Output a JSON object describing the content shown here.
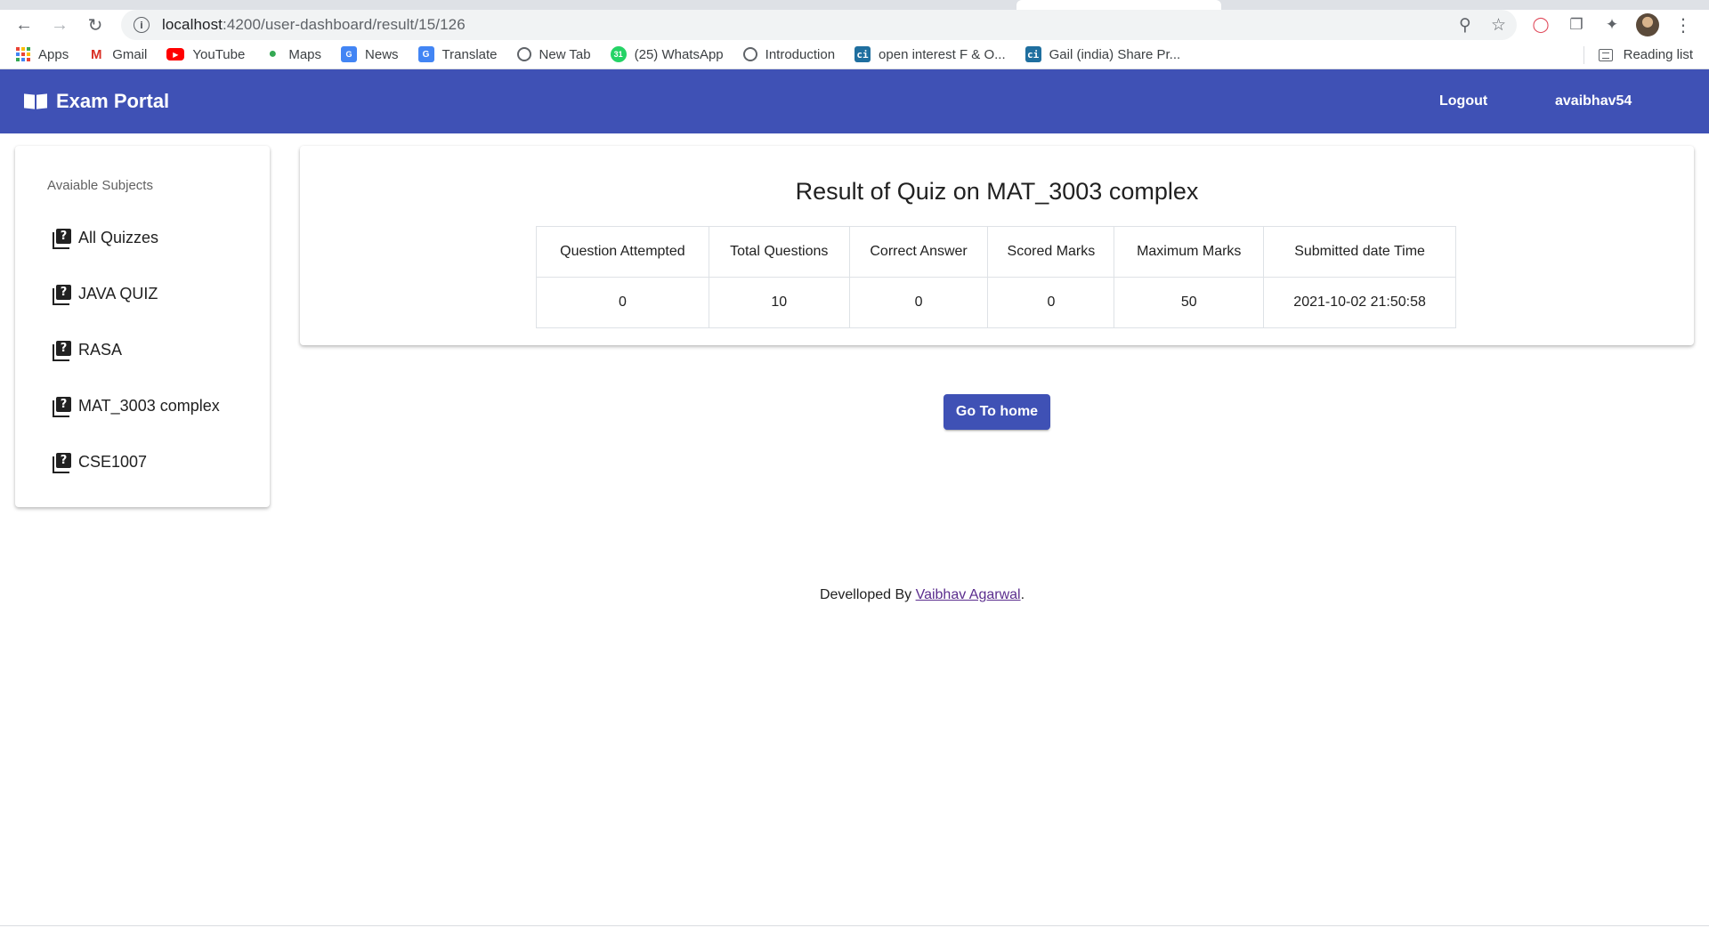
{
  "browser": {
    "url_host": "localhost",
    "url_path": ":4200/user-dashboard/result/15/126",
    "bookmarks": [
      {
        "label": "Apps",
        "icon": "apps-grid-icon"
      },
      {
        "label": "Gmail",
        "icon": "gmail-icon"
      },
      {
        "label": "YouTube",
        "icon": "youtube-icon"
      },
      {
        "label": "Maps",
        "icon": "maps-pin-icon"
      },
      {
        "label": "News",
        "icon": "google-news-icon"
      },
      {
        "label": "Translate",
        "icon": "translate-icon"
      },
      {
        "label": "New Tab",
        "icon": "globe-icon"
      },
      {
        "label": "(25) WhatsApp",
        "icon": "whatsapp-icon"
      },
      {
        "label": "Introduction",
        "icon": "globe-icon"
      },
      {
        "label": "open interest F & O...",
        "icon": "ci-icon"
      },
      {
        "label": "Gail (india) Share Pr...",
        "icon": "ci-icon"
      }
    ],
    "reading_list": "Reading list"
  },
  "header": {
    "brand": "Exam Portal",
    "logout": "Logout",
    "username": "avaibhav54",
    "color": "#3f51b5"
  },
  "sidebar": {
    "heading": "Avaiable Subjects",
    "items": [
      {
        "label": "All Quizzes"
      },
      {
        "label": "JAVA QUIZ"
      },
      {
        "label": "RASA"
      },
      {
        "label": "MAT_3003 complex"
      },
      {
        "label": "CSE1007"
      }
    ]
  },
  "result": {
    "title": "Result of Quiz on MAT_3003 complex",
    "columns": [
      "Question Attempted",
      "Total Questions",
      "Correct Answer",
      "Scored Marks",
      "Maximum Marks",
      "Submitted date Time"
    ],
    "row": [
      "0",
      "10",
      "0",
      "0",
      "50",
      "2021-10-02 21:50:58"
    ]
  },
  "actions": {
    "home_button": "Go To home"
  },
  "footer": {
    "prefix": "Develloped By ",
    "author": "Vaibhav Agarwal",
    "suffix": "."
  }
}
